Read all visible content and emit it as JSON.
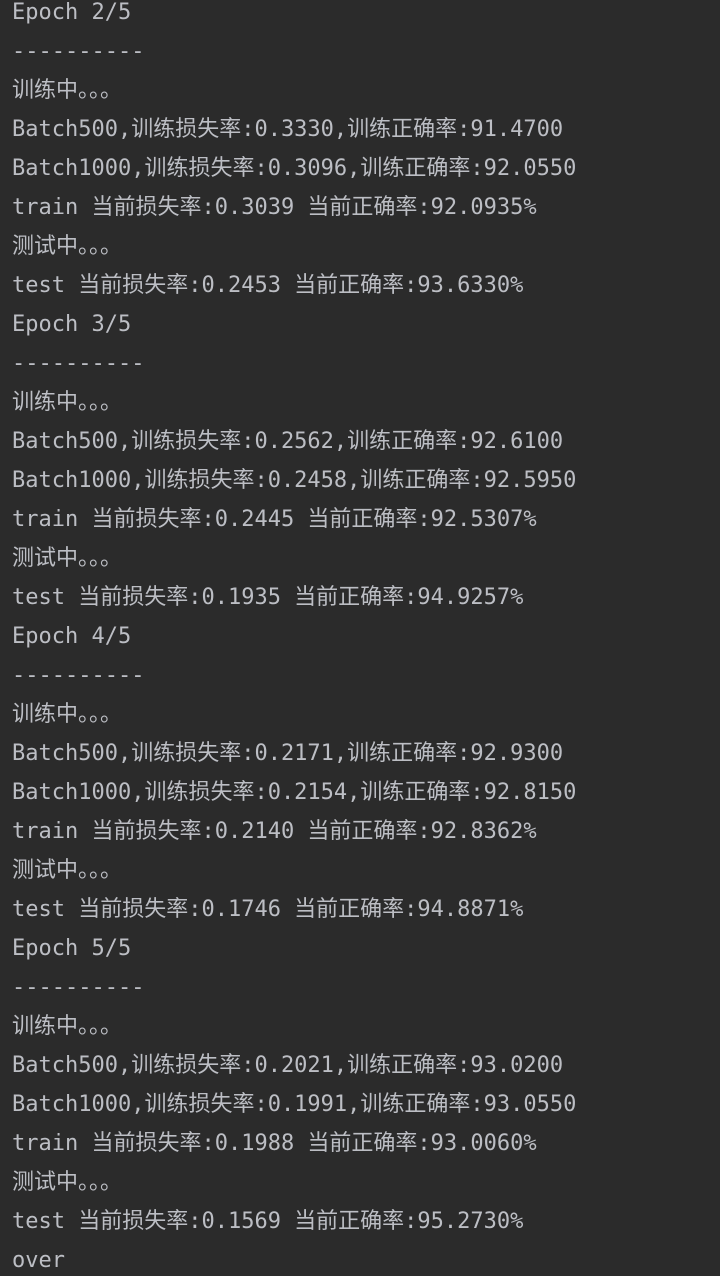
{
  "theme": {
    "background": "#2b2b2b",
    "text_color": "#bcbec4"
  },
  "console": {
    "lines": [
      "Epoch 2/5",
      "----------",
      "训练中。。。",
      "Batch500,训练损失率:0.3330,训练正确率:91.4700",
      "Batch1000,训练损失率:0.3096,训练正确率:92.0550",
      "train 当前损失率:0.3039 当前正确率:92.0935%",
      "测试中。。。",
      "test 当前损失率:0.2453 当前正确率:93.6330%",
      "Epoch 3/5",
      "----------",
      "训练中。。。",
      "Batch500,训练损失率:0.2562,训练正确率:92.6100",
      "Batch1000,训练损失率:0.2458,训练正确率:92.5950",
      "train 当前损失率:0.2445 当前正确率:92.5307%",
      "测试中。。。",
      "test 当前损失率:0.1935 当前正确率:94.9257%",
      "Epoch 4/5",
      "----------",
      "训练中。。。",
      "Batch500,训练损失率:0.2171,训练正确率:92.9300",
      "Batch1000,训练损失率:0.2154,训练正确率:92.8150",
      "train 当前损失率:0.2140 当前正确率:92.8362%",
      "测试中。。。",
      "test 当前损失率:0.1746 当前正确率:94.8871%",
      "Epoch 5/5",
      "----------",
      "训练中。。。",
      "Batch500,训练损失率:0.2021,训练正确率:93.0200",
      "Batch1000,训练损失率:0.1991,训练正确率:93.0550",
      "train 当前损失率:0.1988 当前正确率:93.0060%",
      "测试中。。。",
      "test 当前损失率:0.1569 当前正确率:95.2730%",
      "over"
    ]
  }
}
